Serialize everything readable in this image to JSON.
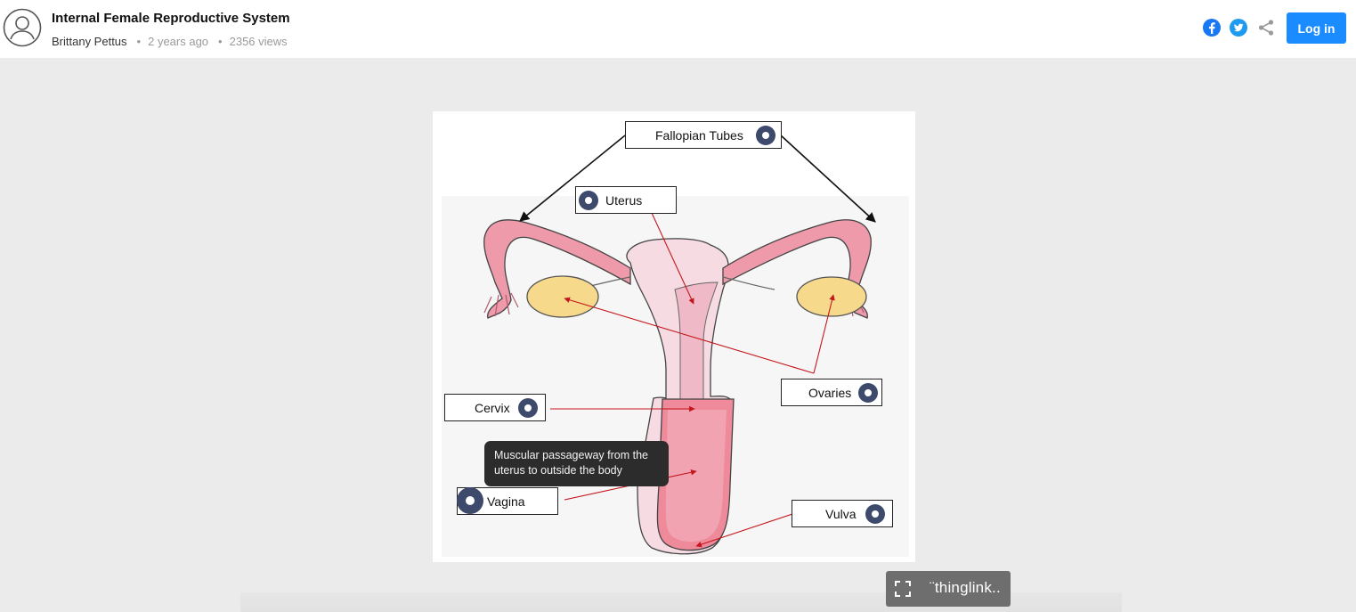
{
  "header": {
    "title": "Internal Female Reproductive System",
    "author": "Brittany Pettus",
    "time_ago": "2 years ago",
    "views": "2356 views",
    "login_label": "Log in",
    "separator": "•",
    "icons": {
      "avatar": "user-avatar-icon",
      "facebook": "facebook-icon",
      "twitter": "twitter-icon",
      "share": "share-icon"
    },
    "colors": {
      "facebook": "#1877f2",
      "twitter": "#1d9bf0",
      "share": "#9a9a9a",
      "login_bg": "#1a8cff"
    }
  },
  "image": {
    "labels": {
      "fallopian_tubes": "Fallopian Tubes",
      "uterus": "Uterus",
      "ovaries": "Ovaries",
      "cervix": "Cervix",
      "vagina": "Vagina",
      "vulva": "Vulva"
    },
    "tooltip": "Muscular passageway from the uterus to outside the body",
    "tag_color": "#3d4a6b"
  },
  "viewer": {
    "brand": "¨thinglink..",
    "fullscreen_icon": "fullscreen-icon"
  }
}
